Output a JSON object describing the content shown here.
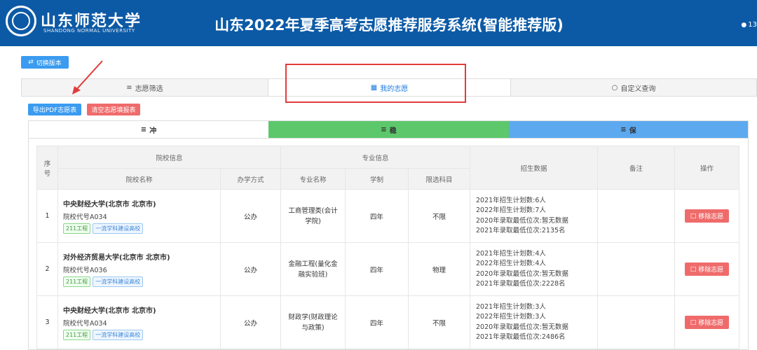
{
  "header": {
    "university_name": "山东师范大学",
    "university_en": "SHANDONG NORMAL UNIVERSITY",
    "system_title": "山东2022年夏季高考志愿推荐服务系统(智能推荐版)",
    "user_text": "13"
  },
  "toolbar": {
    "switch_label": "切换版本"
  },
  "tabs": [
    {
      "label": "志愿筛选",
      "icon": "filter-icon"
    },
    {
      "label": "我的志愿",
      "icon": "document-icon"
    },
    {
      "label": "自定义查询",
      "icon": "circle-icon"
    }
  ],
  "actions": {
    "export_label": "导出PDF志愿表",
    "clear_label": "清空志愿填报表"
  },
  "categories": [
    {
      "label": "冲",
      "color": "#ffffff"
    },
    {
      "label": "稳",
      "color": "#5cc86b"
    },
    {
      "label": "保",
      "color": "#5ca9f0"
    }
  ],
  "table": {
    "headers": {
      "index": "序号",
      "school_group": "院校信息",
      "school_name": "院校名称",
      "ownership": "办学方式",
      "major_group": "专业信息",
      "major_name": "专业名称",
      "duration": "学制",
      "subjects": "限选科目",
      "admission": "招生数据",
      "notes": "备注",
      "operation": "操作"
    },
    "remove_label": "移除志愿",
    "rows": [
      {
        "index": "1",
        "school": "中央财经大学(北京市 北京市)",
        "code": "院校代号A034",
        "tag1": "211工程",
        "tag2": "一流学科建设高校",
        "ownership": "公办",
        "major": "工商管理类(会计学院)",
        "duration": "四年",
        "subjects": "不限",
        "data": [
          "2021年招生计划数:6人",
          "2022年招生计划数:7人",
          "2020年录取最低位次:暂无数据",
          "2021年录取最低位次:2135名"
        ]
      },
      {
        "index": "2",
        "school": "对外经济贸易大学(北京市 北京市)",
        "code": "院校代号A036",
        "tag1": "211工程",
        "tag2": "一流学科建设高校",
        "ownership": "公办",
        "major": "金融工程(量化金融实验班)",
        "duration": "四年",
        "subjects": "物理",
        "data": [
          "2021年招生计划数:4人",
          "2022年招生计划数:4人",
          "2020年录取最低位次:暂无数据",
          "2021年录取最低位次:2228名"
        ]
      },
      {
        "index": "3",
        "school": "中央财经大学(北京市 北京市)",
        "code": "院校代号A034",
        "tag1": "211工程",
        "tag2": "一流学科建设高校",
        "ownership": "公办",
        "major": "财政学(财政理论与政策)",
        "duration": "四年",
        "subjects": "不限",
        "data": [
          "2021年招生计划数:3人",
          "2022年招生计划数:3人",
          "2020年录取最低位次:暂无数据",
          "2021年录取最低位次:2486名"
        ]
      }
    ]
  },
  "colors": {
    "header_bg": "#0c5aa6",
    "accent_blue": "#3a9bf0",
    "danger_red": "#ef6b6b",
    "annotation_red": "#e23b3b"
  }
}
